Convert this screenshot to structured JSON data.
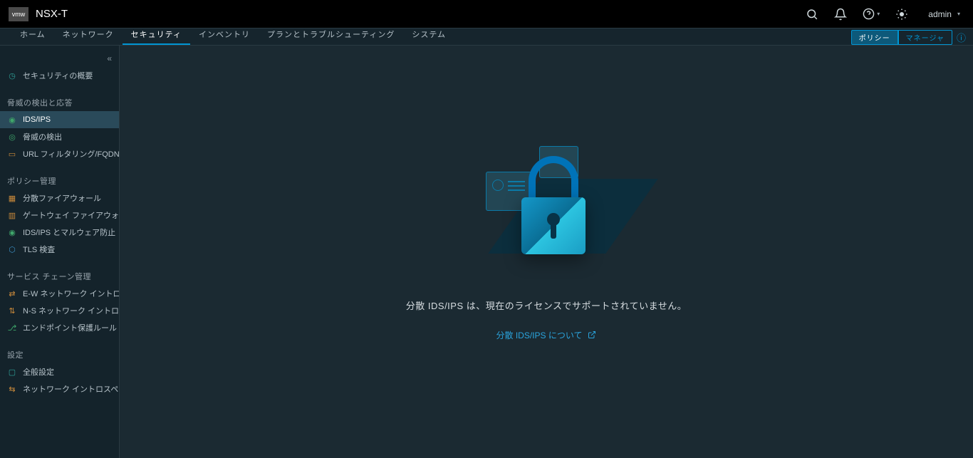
{
  "header": {
    "logo_text": "vmw",
    "product": "NSX-T",
    "help_aria": "ヘルプ",
    "user": "admin"
  },
  "nav": {
    "items": [
      "ホーム",
      "ネットワーク",
      "セキュリティ",
      "インベントリ",
      "プランとトラブルシューティング",
      "システム"
    ],
    "active_index": 2,
    "pill_left": "ポリシー",
    "pill_right": "マネージャ"
  },
  "sidebar": {
    "overview": "セキュリティの概要",
    "sections": [
      {
        "title": "脅威の検出と応答",
        "items": [
          {
            "label": "IDS/IPS",
            "active": true
          },
          {
            "label": "脅威の検出"
          },
          {
            "label": "URL フィルタリング/FQDN ..."
          }
        ]
      },
      {
        "title": "ポリシー管理",
        "items": [
          {
            "label": "分散ファイアウォール"
          },
          {
            "label": "ゲートウェイ ファイアウォール"
          },
          {
            "label": "IDS/IPS とマルウェア防止"
          },
          {
            "label": "TLS 検査"
          }
        ]
      },
      {
        "title": "サービス チェーン管理",
        "items": [
          {
            "label": "E-W ネットワーク イントロス..."
          },
          {
            "label": "N-S ネットワーク イントロス..."
          },
          {
            "label": "エンドポイント保護ルール"
          }
        ]
      },
      {
        "title": "設定",
        "items": [
          {
            "label": "全般設定"
          },
          {
            "label": "ネットワーク イントロスペク..."
          }
        ]
      }
    ]
  },
  "main": {
    "message": "分散 IDS/IPS は、現在のライセンスでサポートされていません。",
    "link_label": "分散 IDS/IPS について"
  }
}
